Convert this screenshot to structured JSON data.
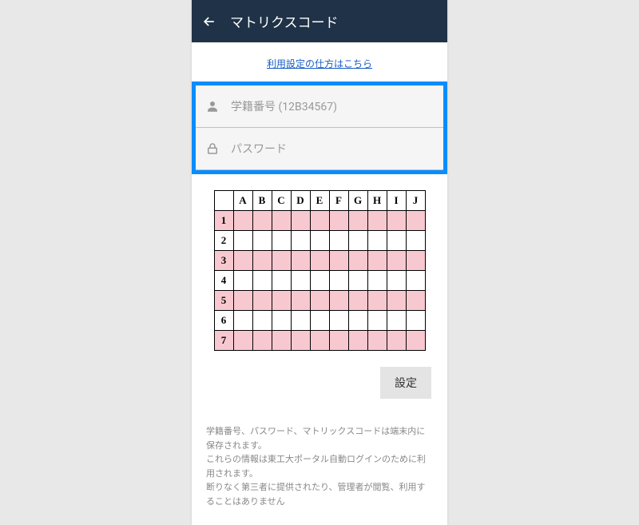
{
  "header": {
    "title": "マトリクスコード"
  },
  "help": {
    "label": "利用設定の仕方はこちら"
  },
  "inputs": {
    "student_id": {
      "placeholder": "学籍番号 (12B34567)",
      "value": ""
    },
    "password": {
      "placeholder": "パスワード",
      "value": ""
    }
  },
  "matrix": {
    "columns": [
      "A",
      "B",
      "C",
      "D",
      "E",
      "F",
      "G",
      "H",
      "I",
      "J"
    ],
    "rows": [
      "1",
      "2",
      "3",
      "4",
      "5",
      "6",
      "7"
    ]
  },
  "button": {
    "settings_label": "設定"
  },
  "disclaimer": {
    "line1": "学籍番号、パスワード、マトリックスコードは端末内に保存されます。",
    "line2": "これらの情報は東工大ポータル自動ログインのために利用されます。",
    "line3": "断りなく第三者に提供されたり、管理者が閲覧、利用することはありません"
  }
}
